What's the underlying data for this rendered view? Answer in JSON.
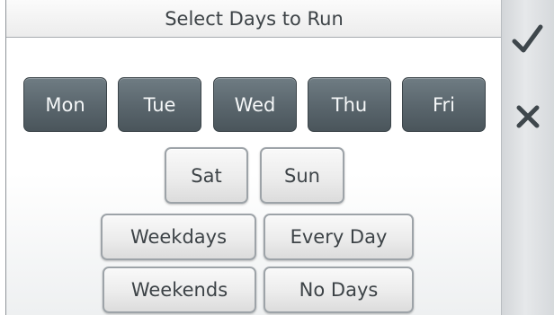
{
  "header": {
    "title": "Select Days to Run"
  },
  "days": {
    "mon": "Mon",
    "tue": "Tue",
    "wed": "Wed",
    "thu": "Thu",
    "fri": "Fri",
    "sat": "Sat",
    "sun": "Sun"
  },
  "presets": {
    "weekdays": "Weekdays",
    "every_day": "Every Day",
    "weekends": "Weekends",
    "no_days": "No Days"
  },
  "actions": {
    "confirm_icon": "checkmark-icon",
    "cancel_icon": "close-icon"
  },
  "colors": {
    "selected_day": "#5b676e",
    "unselected_button": "#ececec",
    "icon": "#3f474c"
  }
}
